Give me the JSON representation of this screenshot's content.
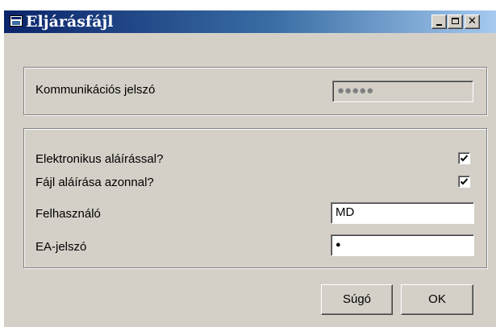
{
  "window": {
    "title": "Eljárásfájl",
    "minimize_label": "_",
    "close_label": "✕"
  },
  "communication": {
    "label": "Kommunikációs jelszó",
    "password_value": "●●●●●"
  },
  "signing": {
    "electronic_signature_label": "Elektronikus aláírással?",
    "electronic_signature_checked": true,
    "sign_immediately_label": "Fájl aláírása azonnal?",
    "sign_immediately_checked": true,
    "user_label": "Felhasználó",
    "user_value": "MD",
    "ea_password_label": "EA-jelszó",
    "ea_password_value": "●"
  },
  "buttons": {
    "help_label": "Súgó",
    "ok_label": "OK"
  }
}
